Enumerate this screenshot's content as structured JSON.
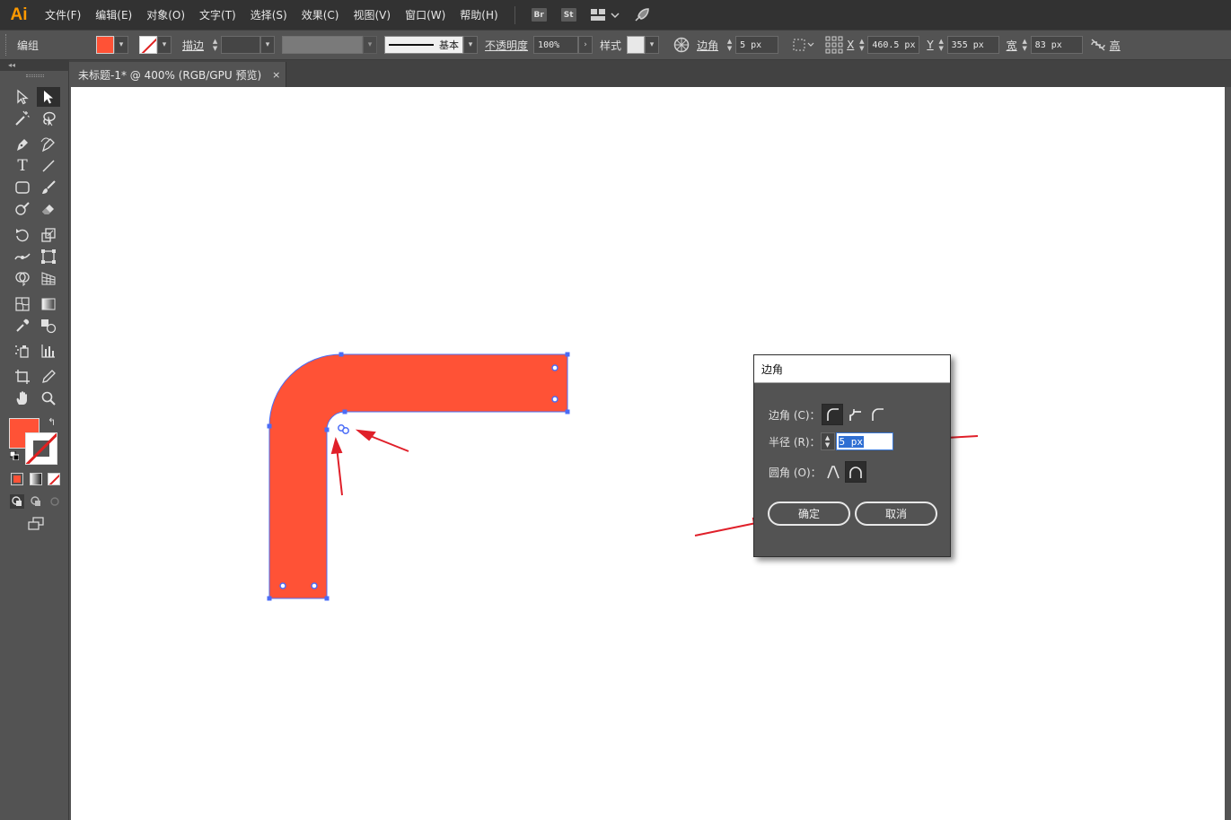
{
  "app": {
    "logo": "Ai"
  },
  "menubar": {
    "items": [
      "文件(F)",
      "编辑(E)",
      "对象(O)",
      "文字(T)",
      "选择(S)",
      "效果(C)",
      "视图(V)",
      "窗口(W)",
      "帮助(H)"
    ],
    "bridge_badge": "Br",
    "stock_badge": "St",
    "icons": [
      "workspace-switcher-icon",
      "chevron-down-icon",
      "rocket-icon"
    ]
  },
  "controlbar": {
    "selection_label": "编组",
    "fill_color": "#ff5236",
    "stroke_label": "描边",
    "stroke_style": "基本",
    "opacity_label": "不透明度",
    "opacity_value": "100%",
    "style_label": "样式",
    "corner_label": "边角",
    "corner_value": "5 px",
    "x_label": "X",
    "x_value": "460.5 px",
    "y_label": "Y",
    "y_value": "355 px",
    "width_label": "宽",
    "width_value": "83 px",
    "height_label_partial": "高"
  },
  "document": {
    "tab_title": "未标题-1* @ 400% (RGB/GPU 预览)",
    "close_glyph": "×"
  },
  "artwork": {
    "shape_color": "#ff5236",
    "selection_color": "#4a6cf7",
    "annotation_color": "#e0202a"
  },
  "dialog": {
    "title": "边角",
    "corner_label": "边角 (C)：",
    "radius_label": "半径 (R)：",
    "radius_value": "5 px",
    "rounding_label": "圆角 (O)：",
    "ok_label": "确定",
    "cancel_label": "取消"
  }
}
